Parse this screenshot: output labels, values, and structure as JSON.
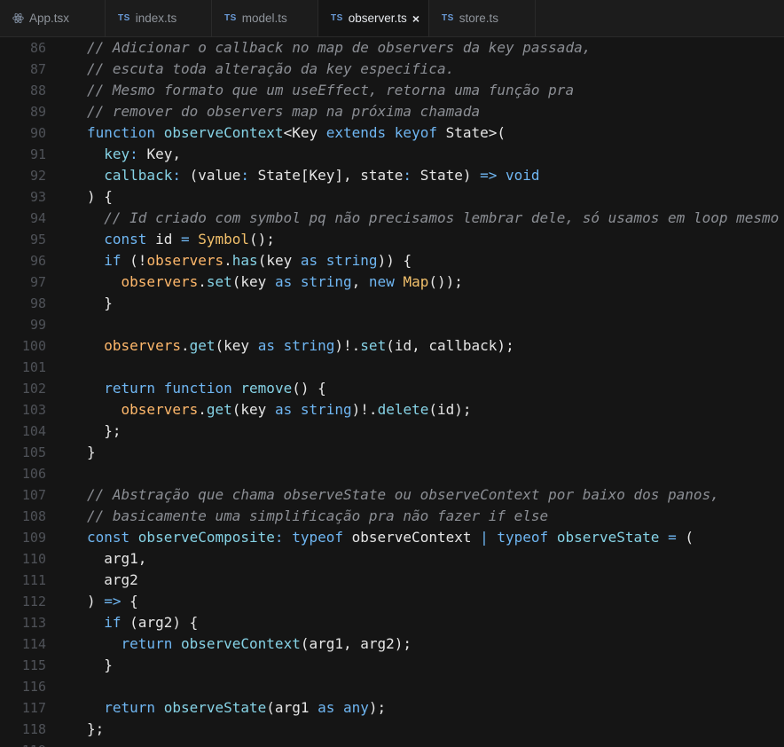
{
  "tabs": [
    {
      "label": "App.tsx",
      "icon": "react-icon"
    },
    {
      "label": "index.ts",
      "icon": "ts-icon"
    },
    {
      "label": "model.ts",
      "icon": "ts-icon"
    },
    {
      "label": "observer.ts",
      "icon": "ts-icon",
      "active": true
    },
    {
      "label": "store.ts",
      "icon": "ts-icon"
    }
  ],
  "ts_badge": "TS",
  "close_glyph": "×",
  "first_line_number": 86,
  "lines": [
    [
      [
        "c",
        "// Adicionar o callback no map de observers da key passada,"
      ]
    ],
    [
      [
        "c",
        "// escuta toda alteração da key especifica."
      ]
    ],
    [
      [
        "c",
        "// Mesmo formato que um useEffect, retorna uma função pra"
      ]
    ],
    [
      [
        "c",
        "// remover do observers map na próxima chamada"
      ]
    ],
    [
      [
        "k",
        "function "
      ],
      [
        "f",
        "observeContext"
      ],
      [
        "w",
        "<Key "
      ],
      [
        "k",
        "extends "
      ],
      [
        "k",
        "keyof "
      ],
      [
        "w",
        "State>("
      ]
    ],
    [
      [
        "w",
        "  "
      ],
      [
        "p",
        "key"
      ],
      [
        "k",
        ": "
      ],
      [
        "w",
        "Key,"
      ]
    ],
    [
      [
        "w",
        "  "
      ],
      [
        "p",
        "callback"
      ],
      [
        "k",
        ": "
      ],
      [
        "w",
        "(value"
      ],
      [
        "k",
        ": "
      ],
      [
        "w",
        "State[Key], state"
      ],
      [
        "k",
        ": "
      ],
      [
        "w",
        "State) "
      ],
      [
        "k",
        "=> "
      ],
      [
        "k",
        "void"
      ]
    ],
    [
      [
        "w",
        ") {"
      ]
    ],
    [
      [
        "w",
        "  "
      ],
      [
        "c",
        "// Id criado com symbol pq não precisamos lembrar dele, só usamos em loop mesmo"
      ]
    ],
    [
      [
        "w",
        "  "
      ],
      [
        "k",
        "const "
      ],
      [
        "w",
        "id "
      ],
      [
        "k",
        "= "
      ],
      [
        "y",
        "Symbol"
      ],
      [
        "w",
        "();"
      ]
    ],
    [
      [
        "w",
        "  "
      ],
      [
        "k",
        "if "
      ],
      [
        "w",
        "(!"
      ],
      [
        "o",
        "observers"
      ],
      [
        "w",
        "."
      ],
      [
        "f",
        "has"
      ],
      [
        "w",
        "(key "
      ],
      [
        "k",
        "as "
      ],
      [
        "k",
        "string"
      ],
      [
        "w",
        ")) {"
      ]
    ],
    [
      [
        "w",
        "    "
      ],
      [
        "o",
        "observers"
      ],
      [
        "w",
        "."
      ],
      [
        "f",
        "set"
      ],
      [
        "w",
        "(key "
      ],
      [
        "k",
        "as "
      ],
      [
        "k",
        "string"
      ],
      [
        "w",
        ", "
      ],
      [
        "k",
        "new "
      ],
      [
        "y",
        "Map"
      ],
      [
        "w",
        "());"
      ]
    ],
    [
      [
        "w",
        "  }"
      ]
    ],
    [
      [
        "w",
        ""
      ]
    ],
    [
      [
        "w",
        "  "
      ],
      [
        "o",
        "observers"
      ],
      [
        "w",
        "."
      ],
      [
        "f",
        "get"
      ],
      [
        "w",
        "(key "
      ],
      [
        "k",
        "as "
      ],
      [
        "k",
        "string"
      ],
      [
        "w",
        ")!."
      ],
      [
        "f",
        "set"
      ],
      [
        "w",
        "(id, callback);"
      ]
    ],
    [
      [
        "w",
        ""
      ]
    ],
    [
      [
        "w",
        "  "
      ],
      [
        "k",
        "return "
      ],
      [
        "k",
        "function "
      ],
      [
        "f",
        "remove"
      ],
      [
        "w",
        "() {"
      ]
    ],
    [
      [
        "w",
        "    "
      ],
      [
        "o",
        "observers"
      ],
      [
        "w",
        "."
      ],
      [
        "f",
        "get"
      ],
      [
        "w",
        "(key "
      ],
      [
        "k",
        "as "
      ],
      [
        "k",
        "string"
      ],
      [
        "w",
        ")!."
      ],
      [
        "f",
        "delete"
      ],
      [
        "w",
        "(id);"
      ]
    ],
    [
      [
        "w",
        "  };"
      ]
    ],
    [
      [
        "w",
        "}"
      ]
    ],
    [
      [
        "w",
        ""
      ]
    ],
    [
      [
        "c",
        "// Abstração que chama observeState ou observeContext por baixo dos panos,"
      ]
    ],
    [
      [
        "c",
        "// basicamente uma simplificação pra não fazer if else"
      ]
    ],
    [
      [
        "k",
        "const "
      ],
      [
        "f",
        "observeComposite"
      ],
      [
        "k",
        ": "
      ],
      [
        "k",
        "typeof "
      ],
      [
        "w",
        "observeContext "
      ],
      [
        "k",
        "| "
      ],
      [
        "k",
        "typeof "
      ],
      [
        "f",
        "observeState "
      ],
      [
        "k",
        "= "
      ],
      [
        "w",
        "("
      ]
    ],
    [
      [
        "w",
        "  arg1,"
      ]
    ],
    [
      [
        "w",
        "  arg2"
      ]
    ],
    [
      [
        "w",
        ") "
      ],
      [
        "k",
        "=> "
      ],
      [
        "w",
        "{"
      ]
    ],
    [
      [
        "w",
        "  "
      ],
      [
        "k",
        "if "
      ],
      [
        "w",
        "(arg2) {"
      ]
    ],
    [
      [
        "w",
        "    "
      ],
      [
        "k",
        "return "
      ],
      [
        "f",
        "observeContext"
      ],
      [
        "w",
        "(arg1, arg2);"
      ]
    ],
    [
      [
        "w",
        "  }"
      ]
    ],
    [
      [
        "w",
        ""
      ]
    ],
    [
      [
        "w",
        "  "
      ],
      [
        "k",
        "return "
      ],
      [
        "f",
        "observeState"
      ],
      [
        "w",
        "(arg1 "
      ],
      [
        "k",
        "as "
      ],
      [
        "k",
        "any"
      ],
      [
        "w",
        ");"
      ]
    ],
    [
      [
        "w",
        "};"
      ]
    ],
    [
      [
        "w",
        ""
      ]
    ]
  ]
}
